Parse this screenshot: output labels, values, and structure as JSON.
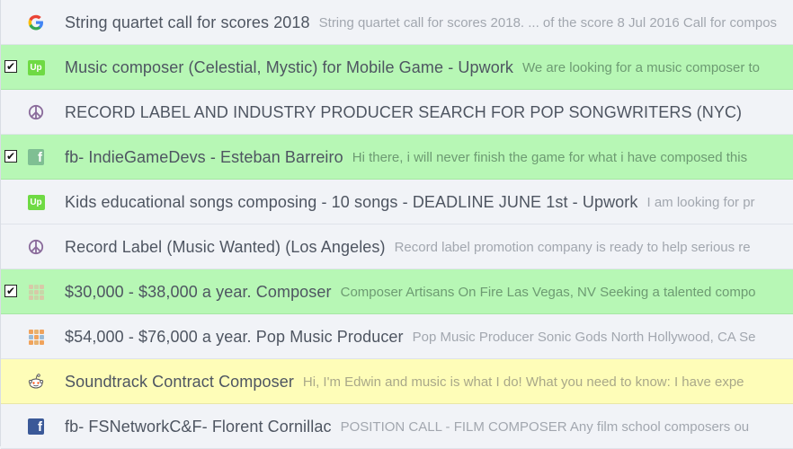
{
  "rows": [
    {
      "subject": "String quartet call for scores 2018",
      "preview": "String quartet call for scores 2018. ... of the score 8 Jul 2016 Call for compos",
      "icon": "google-icon",
      "checked": false,
      "highlight": "plain"
    },
    {
      "subject": "Music composer (Celestial, Mystic) for Mobile Game - Upwork",
      "preview": "We are looking for a music composer to",
      "icon": "upwork-icon",
      "checked": true,
      "highlight": "green"
    },
    {
      "subject": "RECORD LABEL AND INDUSTRY PRODUCER SEARCH FOR POP SONGWRITERS (NYC)",
      "preview": "",
      "icon": "peace-icon",
      "checked": false,
      "highlight": "plain"
    },
    {
      "subject": "fb- IndieGameDevs - Esteban Barreiro",
      "preview": "Hi there, i will never finish the game for what i have composed this",
      "icon": "facebook-icon",
      "checked": true,
      "highlight": "green"
    },
    {
      "subject": "Kids educational songs composing - 10 songs - DEADLINE JUNE 1st - Upwork",
      "preview": "I am looking for pr",
      "icon": "upwork-icon",
      "checked": false,
      "highlight": "plain"
    },
    {
      "subject": "Record Label (Music Wanted) (Los Angeles)",
      "preview": "Record label promotion company is ready to help serious re",
      "icon": "peace-icon",
      "checked": false,
      "highlight": "plain"
    },
    {
      "subject": "$30,000 - $38,000 a year. Composer",
      "preview": "Composer Artisans On Fire Las Vegas, NV Seeking a talented compo",
      "icon": "grid-icon",
      "checked": true,
      "highlight": "green"
    },
    {
      "subject": "$54,000 - $76,000 a year. Pop Music Producer",
      "preview": "Pop Music Producer Sonic Gods North Hollywood, CA Se",
      "icon": "grid-icon",
      "checked": false,
      "highlight": "plain"
    },
    {
      "subject": "Soundtrack Contract Composer",
      "preview": "Hi, I'm Edwin and music is what I do! What you need to know:   I have expe",
      "icon": "reddit-icon",
      "checked": false,
      "highlight": "yellow"
    },
    {
      "subject": "fb- FSNetworkC&F- Florent Cornillac",
      "preview": "POSITION CALL - FILM COMPOSER Any film school composers ou",
      "icon": "facebook-icon",
      "checked": false,
      "highlight": "plain"
    }
  ],
  "colors": {
    "green_highlight": "#b7f7b5",
    "yellow_highlight": "#fefdb8",
    "plain": "#f1f3f7",
    "subject_text": "#4e5561",
    "preview_text": "#a2a7af"
  }
}
